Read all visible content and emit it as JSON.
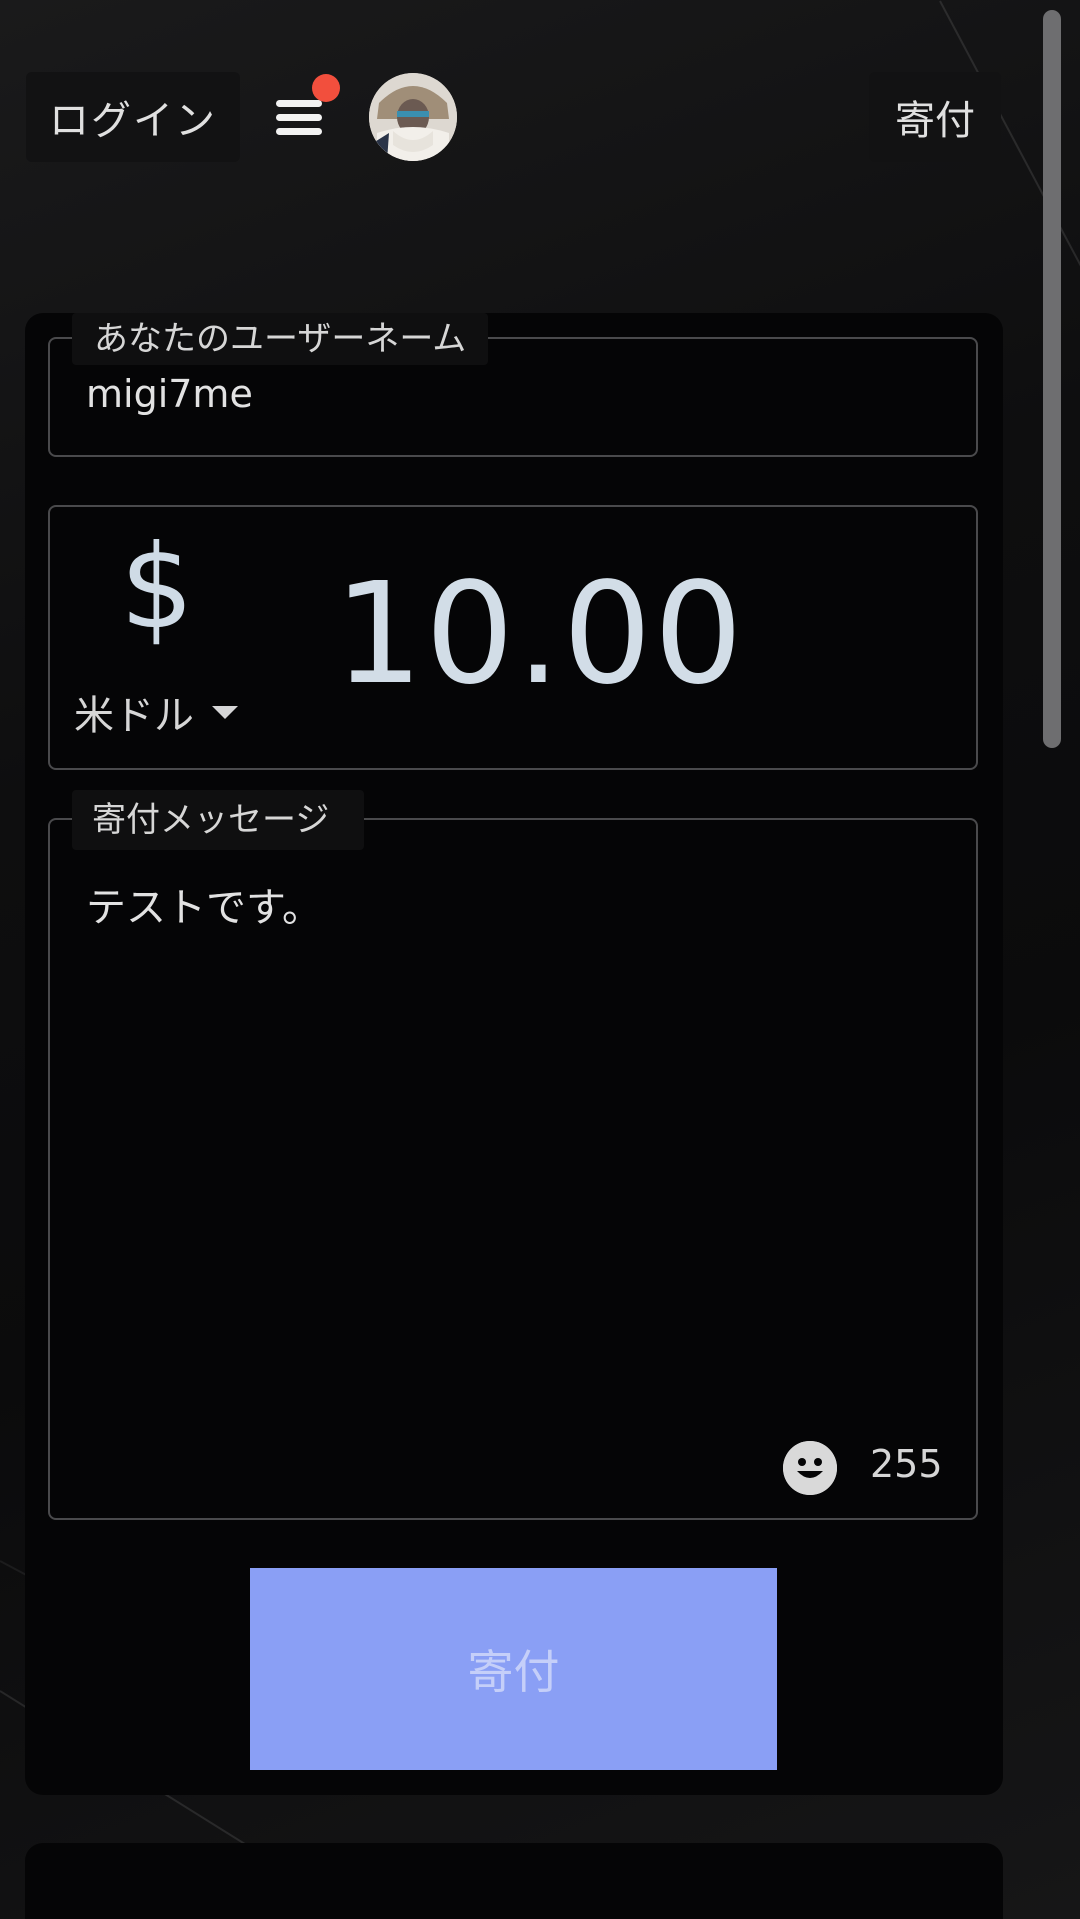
{
  "header": {
    "login_label": "ログイン",
    "donate_label": "寄付",
    "menu_has_notification": true
  },
  "form": {
    "username": {
      "label": "あなたのユーザーネーム",
      "value": "migi7me"
    },
    "amount": {
      "currency_symbol": "$",
      "currency_name": "米ドル",
      "value": "10.00"
    },
    "message": {
      "label": "寄付メッセージ",
      "value": "テストです。",
      "remaining_chars": "255"
    },
    "submit_label": "寄付"
  },
  "colors": {
    "accent": "#8a9ff5",
    "notification": "#f24f3d",
    "background": "#0d0d0e"
  },
  "icons": {
    "menu": "hamburger-icon",
    "emoji": "smiley-icon",
    "dropdown": "caret-down-icon"
  }
}
